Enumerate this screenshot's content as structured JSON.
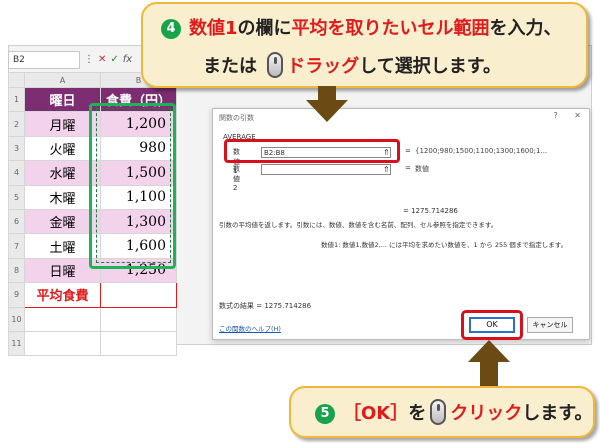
{
  "excel": {
    "name_box": "B2",
    "fx": "fx",
    "col_headers": [
      "A",
      "B"
    ],
    "rows": [
      {
        "n": "1",
        "a": "曜日",
        "b": "食費（円）"
      },
      {
        "n": "2",
        "a": "月曜",
        "b": "1,200"
      },
      {
        "n": "3",
        "a": "火曜",
        "b": "980"
      },
      {
        "n": "4",
        "a": "水曜",
        "b": "1,500"
      },
      {
        "n": "5",
        "a": "木曜",
        "b": "1,100"
      },
      {
        "n": "6",
        "a": "金曜",
        "b": "1,300"
      },
      {
        "n": "7",
        "a": "土曜",
        "b": "1,600"
      },
      {
        "n": "8",
        "a": "日曜",
        "b": "1,250"
      },
      {
        "n": "9",
        "a": "平均食費",
        "b": ""
      },
      {
        "n": "10",
        "a": "",
        "b": ""
      },
      {
        "n": "11",
        "a": "",
        "b": ""
      }
    ]
  },
  "dialog": {
    "title": "関数の引数",
    "controls": "? ✕",
    "function": "AVERAGE",
    "arg1_label": "数値1",
    "arg1_value": "B2:B8",
    "arg1_result": "{1200;980;1500;1100;1300;1600;1...",
    "arg2_label": "数値2",
    "arg2_result": "数値",
    "result_line": "= 1275.714286",
    "desc": "引数の平均値を返します。引数には、数値、数値を含む名前、配列、セル参照を指定できます。",
    "arg_desc": "数値1:   数値1,数値2,... には平均を求めたい数値を、1 から 255 個まで指定します。",
    "formula_result": "数式の結果 =  1275.714286",
    "help_link": "この関数のヘルプ(H)",
    "ok": "OK",
    "cancel": "キャンセル"
  },
  "callout1": {
    "num": "4",
    "p1": "数値1",
    "p2": "の欄に",
    "p3": "平均を取りたいセル範囲",
    "p4": "を入力、",
    "l2a": "または",
    "l2b": "ドラッグ",
    "l2c": "して選択します。"
  },
  "callout2": {
    "num": "5",
    "p1": "［OK］",
    "p2": "を",
    "p3": "クリック",
    "p4": "します。"
  }
}
